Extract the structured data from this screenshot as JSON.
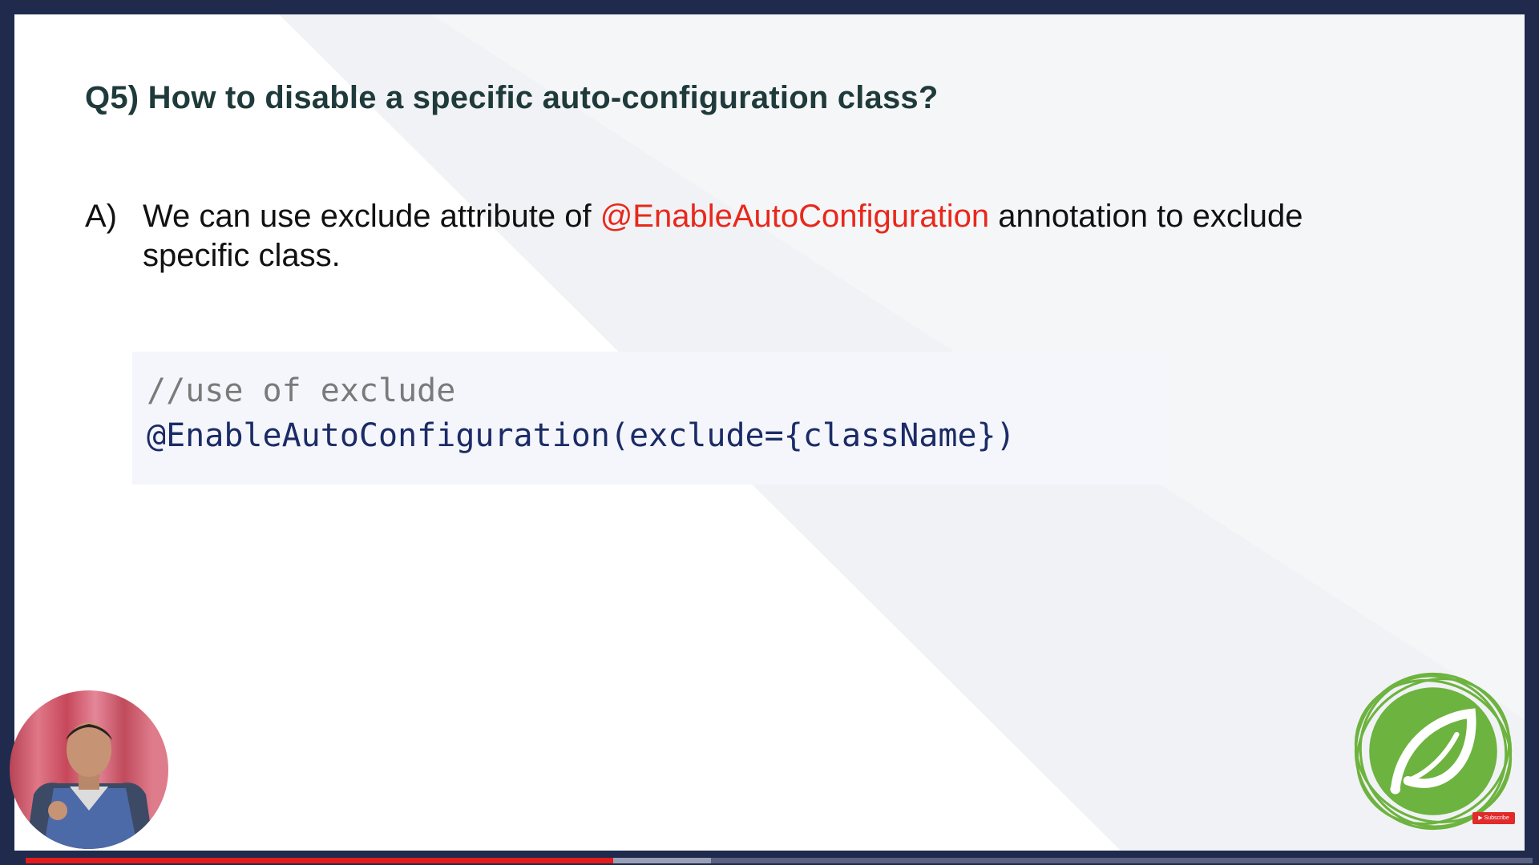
{
  "slide": {
    "question": "Q5) How to disable a specific auto-configuration class?",
    "answer_marker": "A)",
    "answer_part1": "We can use exclude  attribute of ",
    "answer_highlight": "@EnableAutoConfiguration",
    "answer_part2": " annotation to exclude specific class.",
    "code_comment": "//use of exclude",
    "code_line": "@EnableAutoConfiguration(exclude={className})"
  },
  "player": {
    "subscribe_label": "Subscribe",
    "progress_played": 0.39,
    "progress_buffered": 0.455
  },
  "colors": {
    "frame_background": "#1f2a4d",
    "title": "#1f3a3a",
    "highlight": "#e8281b",
    "code_text": "#1b2b66",
    "code_comment": "#7a7a7a",
    "code_background": "#f4f6fb",
    "spring_green": "#6db33f",
    "progress_red": "#e21c1c"
  },
  "icons": {
    "logo": "spring-leaf-icon",
    "subscribe": "youtube-play-icon"
  }
}
